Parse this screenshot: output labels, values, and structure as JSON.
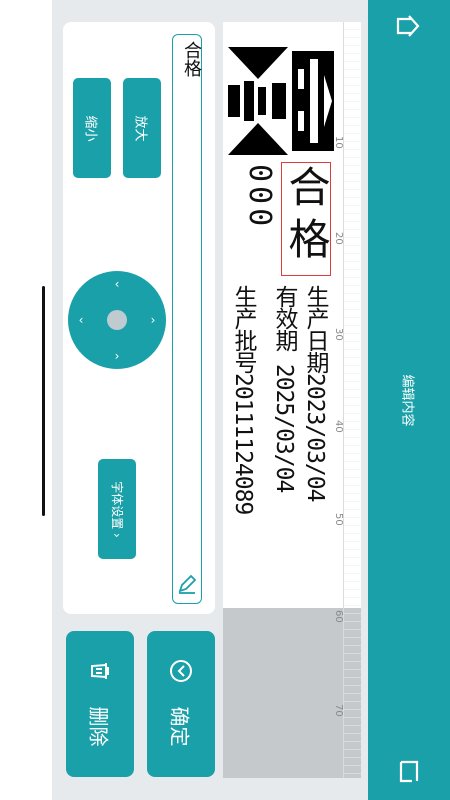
{
  "header": {
    "title": "编辑内容",
    "home_icon": "home-icon",
    "back_icon": "back-icon"
  },
  "editor": {
    "text_value": "合格",
    "edit_icon": "pencil-icon"
  },
  "controls": {
    "zoom_in": "放大",
    "zoom_out": "缩小",
    "font_settings": "字体设置 ›"
  },
  "actions": {
    "delete": "删除",
    "confirm": "确定"
  },
  "canvas": {
    "selected_text": "合格",
    "dot_number": "000",
    "lines": [
      "生产日期2023/03/04",
      "有效期   2025/03/04",
      "生产批号20111124089"
    ],
    "ruler_marks": [
      "10",
      "20",
      "30",
      "40",
      "50",
      "60",
      "70"
    ]
  },
  "colors": {
    "accent": "#1aa0a8",
    "selection": "#e03c3c",
    "workspace": "#e6eaed"
  }
}
